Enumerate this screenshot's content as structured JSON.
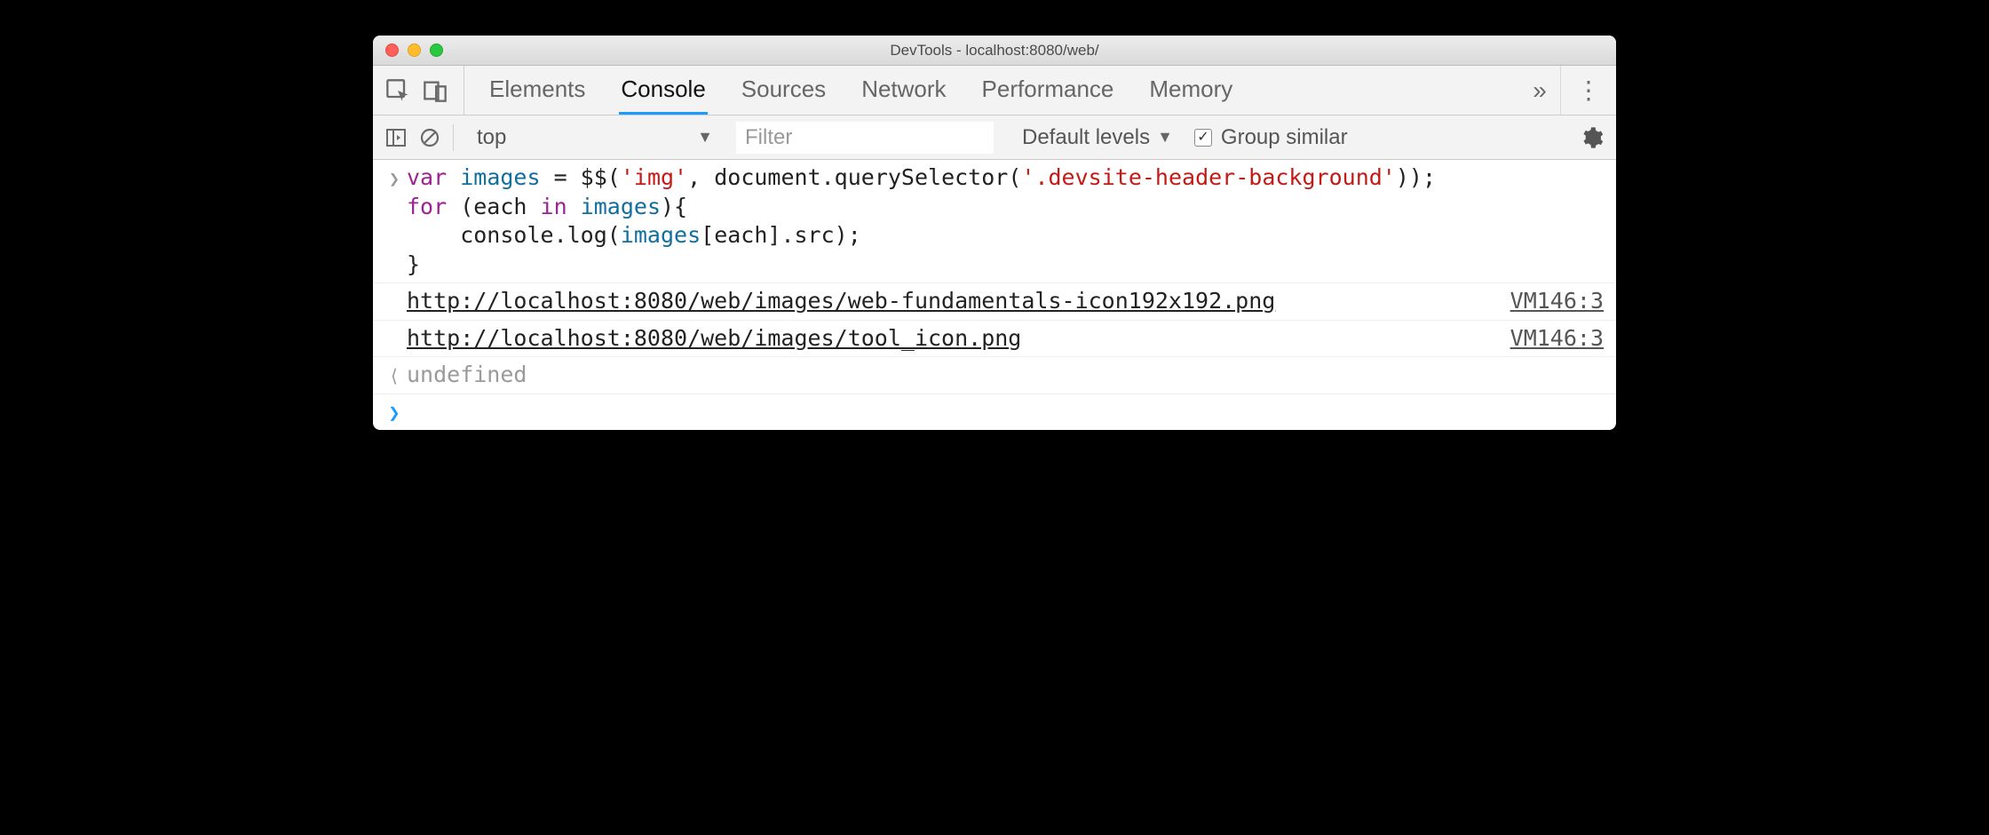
{
  "window": {
    "title": "DevTools - localhost:8080/web/"
  },
  "tabs": {
    "items": [
      "Elements",
      "Console",
      "Sources",
      "Network",
      "Performance",
      "Memory"
    ],
    "activeIndex": 1,
    "overflowGlyph": "»"
  },
  "controls": {
    "context": "top",
    "filterPlaceholder": "Filter",
    "filterValue": "",
    "levelsLabel": "Default levels",
    "groupSimilarLabel": "Group similar",
    "groupSimilarChecked": true
  },
  "code": {
    "tokens": [
      {
        "t": "kw",
        "v": "var"
      },
      {
        "t": "plain",
        "v": " "
      },
      {
        "t": "id",
        "v": "images"
      },
      {
        "t": "plain",
        "v": " = $$("
      },
      {
        "t": "str",
        "v": "'img'"
      },
      {
        "t": "plain",
        "v": ", document.querySelector("
      },
      {
        "t": "str",
        "v": "'.devsite-header-background'"
      },
      {
        "t": "plain",
        "v": "));\n"
      },
      {
        "t": "kw",
        "v": "for"
      },
      {
        "t": "plain",
        "v": " (each "
      },
      {
        "t": "kw",
        "v": "in"
      },
      {
        "t": "plain",
        "v": " "
      },
      {
        "t": "id",
        "v": "images"
      },
      {
        "t": "plain",
        "v": "){\n    console.log("
      },
      {
        "t": "id",
        "v": "images"
      },
      {
        "t": "plain",
        "v": "[each].src);\n}"
      }
    ]
  },
  "logs": [
    {
      "url": "http://localhost:8080/web/images/web-fundamentals-icon192x192.png",
      "source": "VM146:3"
    },
    {
      "url": "http://localhost:8080/web/images/tool_icon.png",
      "source": "VM146:3"
    }
  ],
  "result": "undefined"
}
